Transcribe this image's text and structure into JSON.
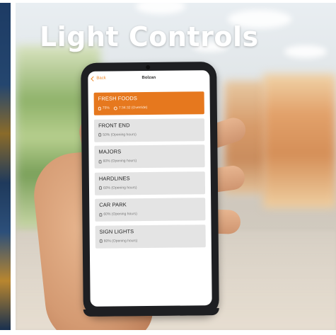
{
  "hero": {
    "title": "Light Controls"
  },
  "app": {
    "back_label": "Back",
    "title": "Bolzan"
  },
  "zones": [
    {
      "name": "FRESH FOODS",
      "level": "75%",
      "status": "7:34:32 (Override)",
      "active": true
    },
    {
      "name": "FRONT END",
      "status": "50% (Opening hours)",
      "active": false
    },
    {
      "name": "MAJORS",
      "status": "60% (Opening hours)",
      "active": false
    },
    {
      "name": "HARDLINES",
      "status": "60% (Opening hours)",
      "active": false
    },
    {
      "name": "CAR PARK",
      "status": "60% (Opening hours)",
      "active": false
    },
    {
      "name": "SIGN LIGHTS",
      "status": "60% (Opening hours)",
      "active": false
    }
  ],
  "colors": {
    "accent": "#e6781e",
    "tile": "#e4e4e4"
  }
}
